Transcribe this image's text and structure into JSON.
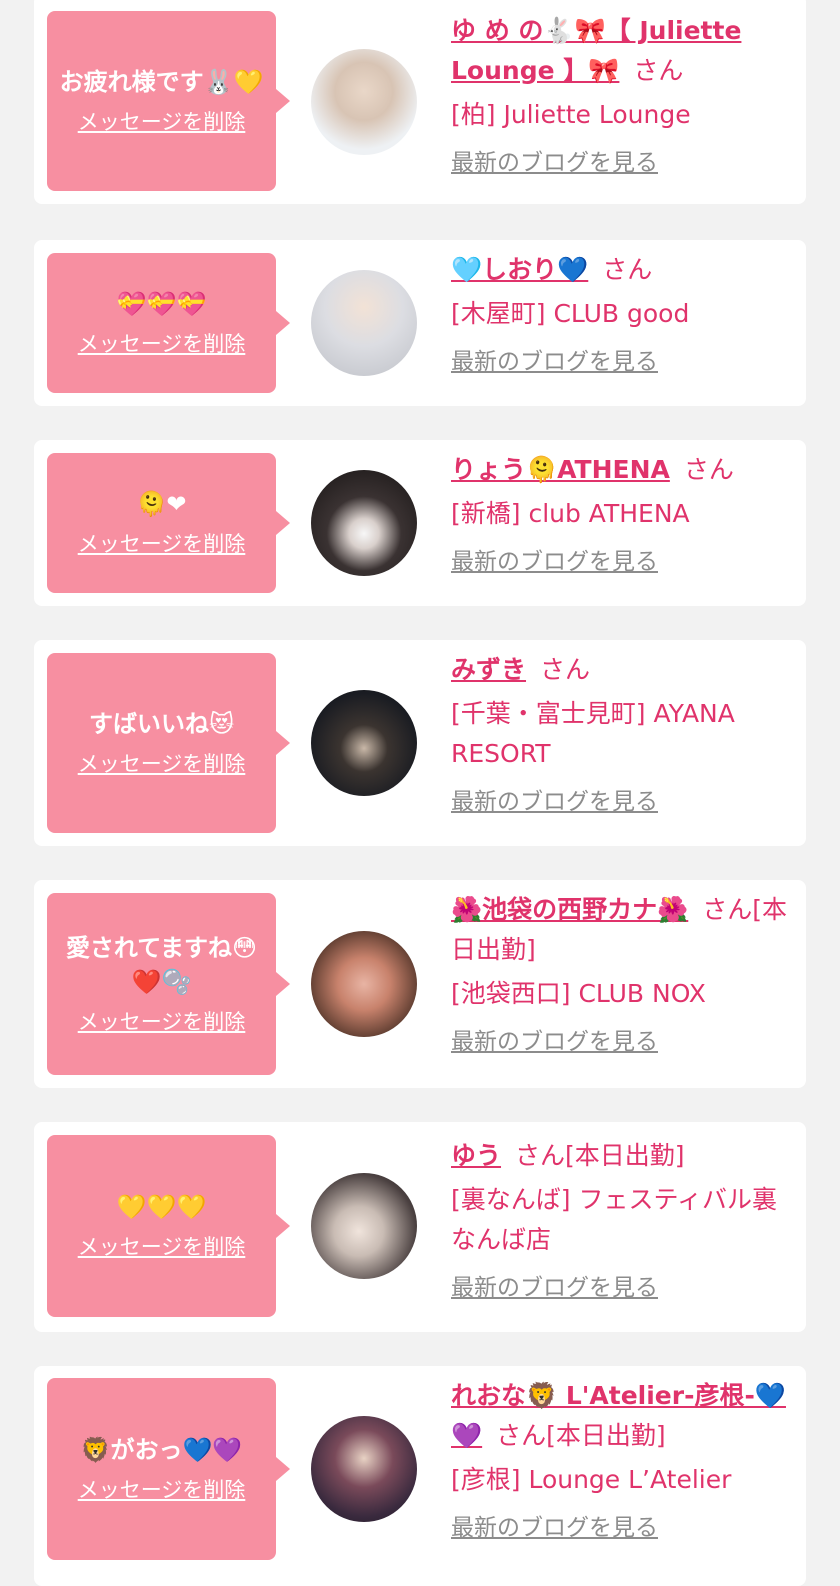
{
  "colors": {
    "accent_pink": "#e0336b",
    "bubble_pink": "#f78fa1",
    "page_bg": "#f2f2f2",
    "card_bg": "#ffffff",
    "link_gray": "#8c8c8c"
  },
  "cards": [
    {
      "message": "お疲れ様です🐰💛",
      "delete_label": "メッセージを削除",
      "name": "ゆ め の🐇🎀【 Juliette Lounge 】🎀",
      "honorific": "さん",
      "extra": "",
      "shop": "[柏] Juliette Lounge",
      "blog_label": "最新のブログを見る"
    },
    {
      "message": "💝💝💝",
      "delete_label": "メッセージを削除",
      "name": "🩵しおり💙",
      "honorific": "さん",
      "extra": "",
      "shop": "[木屋町] CLUB good",
      "blog_label": "最新のブログを見る"
    },
    {
      "message": "🫠❤",
      "delete_label": "メッセージを削除",
      "name": "りょう🫠ATHENA",
      "honorific": "さん",
      "extra": "",
      "shop": "[新橋] club ATHENA",
      "blog_label": "最新のブログを見る"
    },
    {
      "message": "すばいいね😻",
      "delete_label": "メッセージを削除",
      "name": "みずき",
      "honorific": "さん",
      "extra": "",
      "shop": "[千葉・富士見町] AYANA RESORT",
      "blog_label": "最新のブログを見る"
    },
    {
      "message": "愛されてますね😳❤️🫧",
      "delete_label": "メッセージを削除",
      "name": "🌺池袋の西野カナ🌺",
      "honorific": "さん",
      "extra": "[本日出勤]",
      "shop": "[池袋西口] CLUB NOX",
      "blog_label": "最新のブログを見る"
    },
    {
      "message": "💛💛💛",
      "delete_label": "メッセージを削除",
      "name": "ゆう",
      "honorific": "さん",
      "extra": "[本日出勤]",
      "shop": "[裏なんば] フェスティバル裏なんば店",
      "blog_label": "最新のブログを見る"
    },
    {
      "message": "🦁がおっ💙💜",
      "delete_label": "メッセージを削除",
      "name": "れおな🦁 L'Atelier-彦根-💙💜",
      "honorific": "さん",
      "extra": "[本日出勤]",
      "shop": "[彦根] Lounge L’Atelier",
      "blog_label": "最新のブログを見る"
    }
  ]
}
